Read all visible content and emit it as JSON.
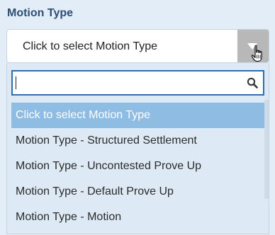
{
  "field": {
    "label": "Motion Type",
    "selected_text": "Click to select Motion Type"
  },
  "search": {
    "value": "",
    "placeholder": ""
  },
  "options": [
    "Click to select Motion Type",
    "Motion Type - Structured Settlement",
    "Motion Type - Uncontested Prove Up",
    "Motion Type - Default Prove Up",
    "Motion Type - Motion"
  ],
  "highlighted_index": 0,
  "icons": {
    "dropdown_arrow": "chevron-down-icon",
    "cursor": "hand-pointer-icon",
    "search": "search-icon"
  },
  "colors": {
    "label": "#2d4e75",
    "highlight": "#8ebce2",
    "search_border": "#2d6fae",
    "arrow_bg": "#b8b8b8"
  }
}
